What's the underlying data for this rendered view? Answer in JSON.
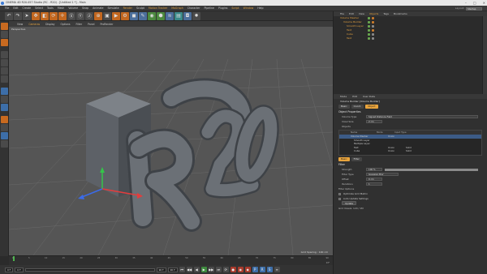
{
  "window": {
    "title": "CINEMA 4D R20.057 Studio (RC - R20) - [Untitled 1 *] - Main",
    "controls": [
      "–",
      "□",
      "✕"
    ]
  },
  "menubar": {
    "items": [
      "File",
      "Edit",
      "Create",
      "Select",
      "Tools",
      "Mesh",
      "Volume",
      "Snap",
      "Animate",
      "Simulate",
      "Render",
      "Sculpt",
      "Motion Tracker",
      "MoGraph",
      "Character",
      "Pipeline",
      "Plugins",
      "Script",
      "Window",
      "Help"
    ],
    "highlighted": [
      "Render",
      "Motion Tracker",
      "MoGraph",
      "Script",
      "Window"
    ],
    "layout_label": "Layout:",
    "layout_value": "Startup"
  },
  "viewport": {
    "menu": [
      "View",
      "Cameras",
      "Display",
      "Options",
      "Filter",
      "Panel",
      "ProRender"
    ],
    "menu_highlight": "Cameras",
    "label": "Perspective",
    "grid_spacing": "Grid Spacing : 100 cm",
    "background": "#555555",
    "shape_color": "#6b7076",
    "shape_shadow": "#3e4247"
  },
  "timeline": {
    "ticks": [
      "0",
      "5",
      "10",
      "15",
      "20",
      "25",
      "30",
      "35",
      "40",
      "45",
      "50",
      "55",
      "60",
      "65",
      "70",
      "75",
      "80",
      "85",
      "90"
    ],
    "current_frame_label": "0 F"
  },
  "controls": {
    "start_frame": "0 F",
    "current_frame": "0 F",
    "end_frame": "90 F",
    "end_frame2": "90 F",
    "buttons": [
      "⏮",
      "◀◀",
      "◀",
      "▶",
      "▶▶",
      "⏭",
      "⟳"
    ]
  },
  "object_manager": {
    "menu": [
      "File",
      "Edit",
      "View",
      "Objects",
      "Tags",
      "Bookmarks"
    ],
    "menu_highlight": "Objects",
    "search_placeholder": "",
    "rows": [
      {
        "name": "Volume Mesher",
        "indent": 0,
        "color": "orange"
      },
      {
        "name": "Volume Builder",
        "indent": 1,
        "color": "orange"
      },
      {
        "name": "Smooth Layer",
        "indent": 2,
        "color": "orange"
      },
      {
        "name": "Text",
        "indent": 2,
        "color": "orange"
      },
      {
        "name": "Cube",
        "indent": 2,
        "color": "orange"
      },
      {
        "name": "Text",
        "indent": 2,
        "color": "orange"
      }
    ]
  },
  "attribute_manager": {
    "head": [
      "Mode",
      "Edit",
      "User Data"
    ],
    "title": "Volume Builder [Volume Builder]",
    "tabs": [
      "Basic",
      "Coord.",
      "Object"
    ],
    "selected_tab": "Object",
    "section": "Object Properties",
    "volume_type_label": "Volume Type",
    "volume_type_value": "Signed Distance Field",
    "voxel_size_label": "Voxel Size",
    "voxel_size_value": "2 cm",
    "objects_label": "Objects",
    "list_headers": [
      "Name",
      "Mode",
      "Input Type"
    ],
    "list_rows": [
      {
        "name": "Volume Mesher",
        "mode": "Union",
        "type": "",
        "selected": true
      },
      {
        "name": "Smooth Layer",
        "mode": "",
        "type": ""
      },
      {
        "name": "Multiple Layer",
        "mode": "",
        "type": ""
      },
      {
        "name": "Text",
        "mode": "Union",
        "type": "Solid"
      },
      {
        "name": "Cube",
        "mode": "Union",
        "type": "Solid"
      }
    ],
    "filter_tabs": [
      "Basic",
      "Filter"
    ],
    "filter_selected": "Basic",
    "filter_section": "Filter",
    "strength_label": "Strength",
    "strength_value": "100 %",
    "strength_level": 1.0,
    "filter_type_label": "Filter Type",
    "filter_type_value": "Gaussian Blur",
    "offset_label": "Offset",
    "offset_value": "0 cm",
    "iterations_label": "Iterations",
    "iterations_value": "1",
    "filter_options_label": "Filter Options",
    "optimize_label": "Optimize Grid Matrix",
    "auto_update_label": "Auto Update Settings",
    "update_button": "Update",
    "status": "Grid Voxels: 120 / 1M"
  },
  "colors": {
    "accent": "#e9a43c",
    "selection": "#3c5b86",
    "x_axis": "#e23d3d",
    "y_axis": "#35c44a",
    "z_axis": "#3b6be8"
  }
}
